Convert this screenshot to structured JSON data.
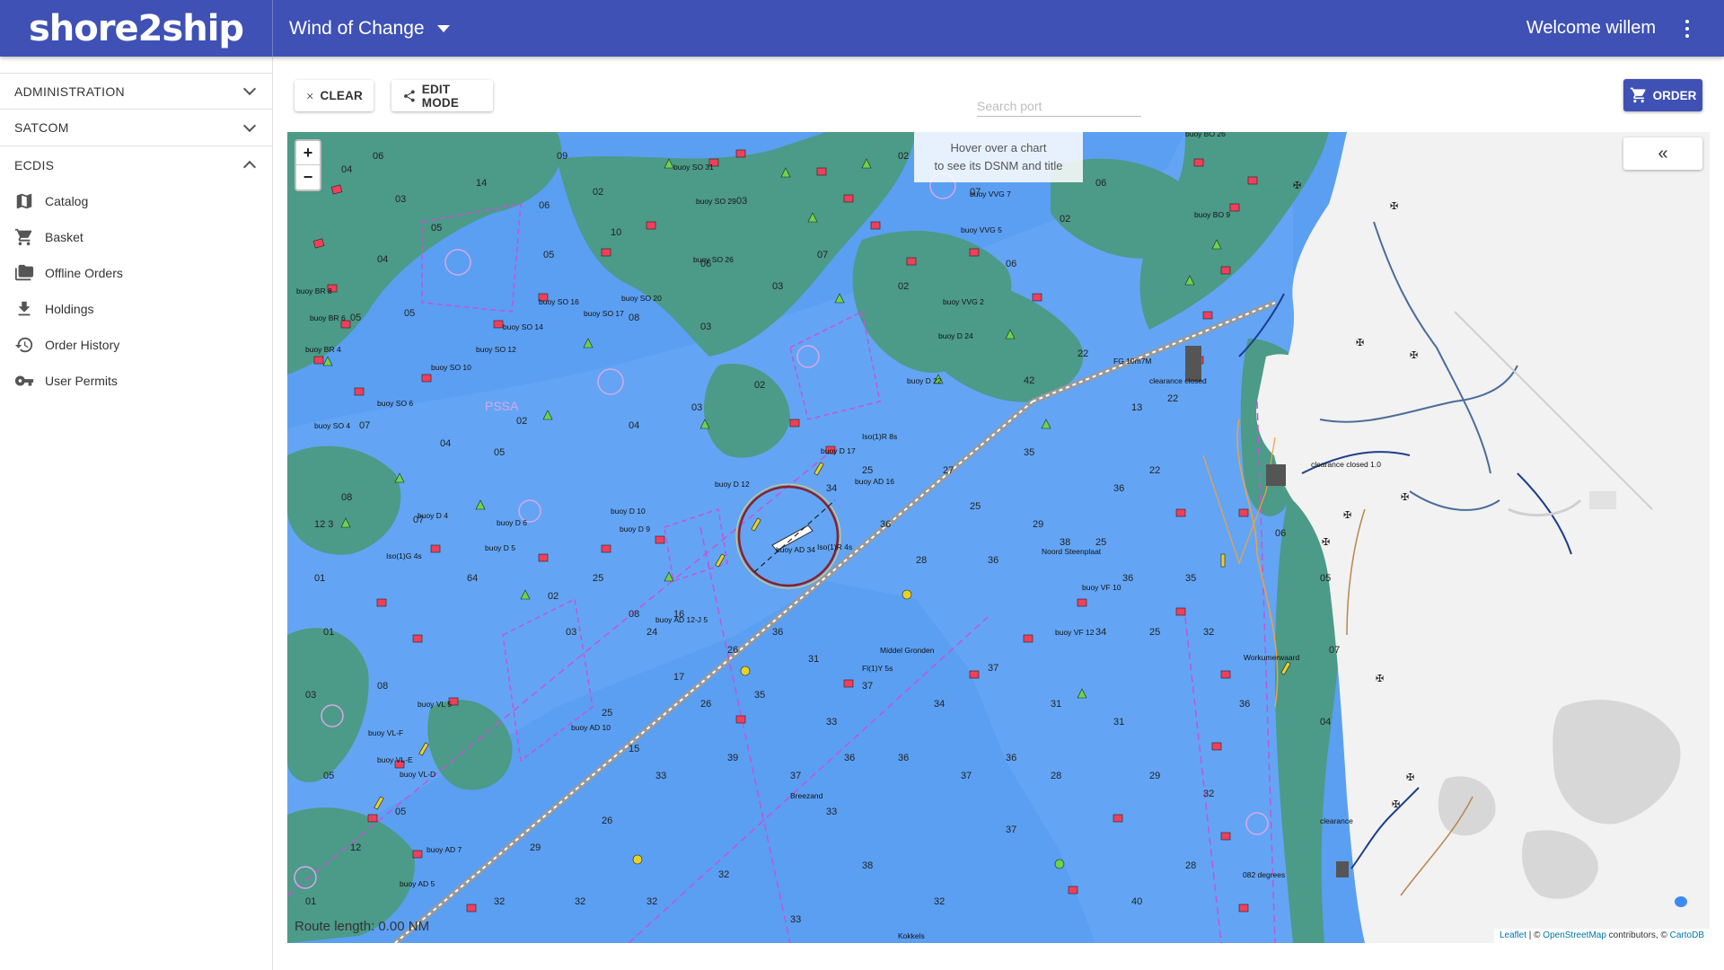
{
  "app": {
    "logo": "shore2ship",
    "vessel": "Wind of Change",
    "welcome": "Welcome willem"
  },
  "sidebar": {
    "sections": [
      {
        "label": "ADMINISTRATION",
        "expanded": false
      },
      {
        "label": "SATCOM",
        "expanded": false
      },
      {
        "label": "ECDIS",
        "expanded": true
      }
    ],
    "items": [
      {
        "label": "Catalog",
        "icon": "map-icon"
      },
      {
        "label": "Basket",
        "icon": "cart-icon"
      },
      {
        "label": "Offline Orders",
        "icon": "folders-icon"
      },
      {
        "label": "Holdings",
        "icon": "download-icon"
      },
      {
        "label": "Order History",
        "icon": "history-icon"
      },
      {
        "label": "User Permits",
        "icon": "key-icon"
      }
    ]
  },
  "toolbar": {
    "clear_label": "CLEAR",
    "edit_label": "EDIT MODE",
    "search_placeholder": "Search port",
    "order_label": "ORDER"
  },
  "map": {
    "zoom_in": "+",
    "zoom_out": "−",
    "hint_line1": "Hover over a chart",
    "hint_line2": "to see its DSNM and title",
    "collapse_label": "«",
    "route_length": "Route length: 0.00 NM",
    "attribution_leaflet": "Leaflet",
    "attribution_sep1": " | © ",
    "attribution_osm": "OpenStreetMap",
    "attribution_sep2": " contributors, © ",
    "attribution_carto": "CartoDB",
    "labels": [
      "buoy SO 31",
      "buoy SO 29",
      "buoy SO 26",
      "buoy SO 20",
      "buoy SO 17",
      "buoy SO 16",
      "buoy SO 14",
      "buoy SO 12",
      "buoy SO 10",
      "buoy SO 6",
      "buoy SO 4",
      "buoy BR 6",
      "buoy BR 4",
      "buoy BR 8",
      "buoy D 24",
      "buoy D 22",
      "buoy D 17",
      "buoy D 12",
      "buoy D 10",
      "buoy D 9",
      "buoy D 6",
      "buoy D 5",
      "buoy D 4",
      "buoy AD 34",
      "buoy AD 16",
      "buoy AD 12-J 5",
      "buoy AD 10",
      "buoy AD 7",
      "buoy AD 5",
      "buoy VL 5",
      "buoy VL-F",
      "buoy VL-E",
      "buoy VL-D",
      "buoy VF 10",
      "buoy VF 12",
      "buoy VVG 2",
      "buoy VVG 5",
      "buoy VVG 7",
      "buoy BO 26",
      "buoy BO 9",
      "Noord Steenplaat",
      "Middel Gronden",
      "Breezand",
      "Workumerwaard",
      "Kokkels",
      "082 degrees",
      "Iso(1)R 4s",
      "Iso(1)G 4s",
      "Fl(1)Y 5s",
      "clearance closed",
      "PSSA",
      "FG 10m7M",
      "Iso(1)R 8s"
    ]
  }
}
